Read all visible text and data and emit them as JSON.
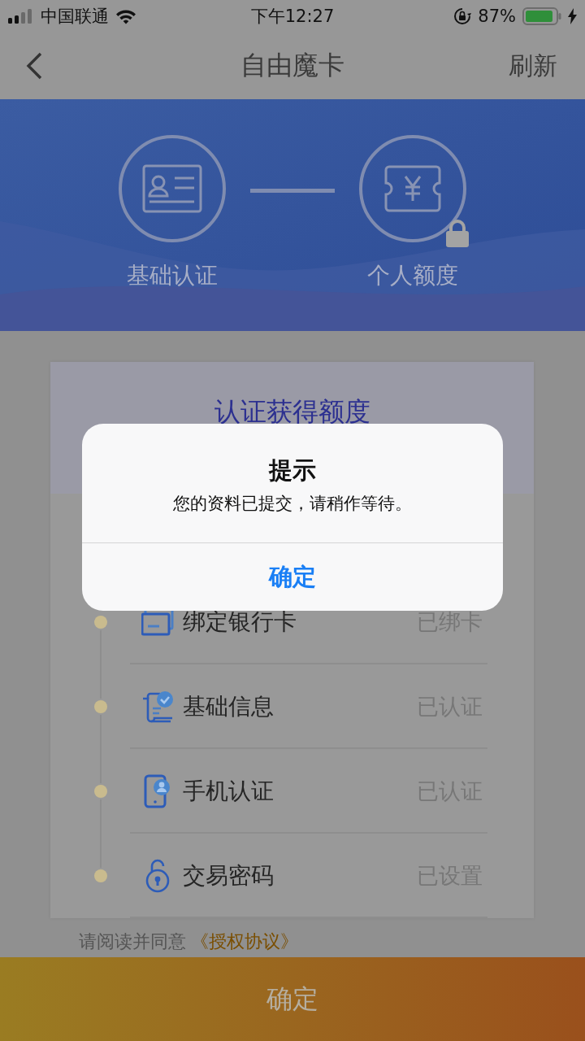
{
  "status_bar": {
    "carrier": "中国联通",
    "time": "下午12:27",
    "battery": "87%"
  },
  "nav": {
    "title": "自由魔卡",
    "action": "刷新"
  },
  "steps": [
    {
      "kind": "id-card",
      "label": "基础认证",
      "locked": false
    },
    {
      "kind": "ticket",
      "label": "个人额度",
      "locked": true
    }
  ],
  "card": {
    "title": "认证获得额度",
    "items": [
      {
        "kind": "bank-card",
        "label": "绑定银行卡",
        "status": "已绑卡"
      },
      {
        "kind": "info",
        "label": "基础信息",
        "status": "已认证"
      },
      {
        "kind": "phone",
        "label": "手机认证",
        "status": "已认证"
      },
      {
        "kind": "password",
        "label": "交易密码",
        "status": "已设置"
      }
    ]
  },
  "agreement": {
    "text": "请阅读并同意",
    "link": "《授权协议》"
  },
  "submit_button": "确定",
  "dialog": {
    "title": "提示",
    "message": "您的资料已提交，请稍作等待。",
    "button": "确定"
  }
}
